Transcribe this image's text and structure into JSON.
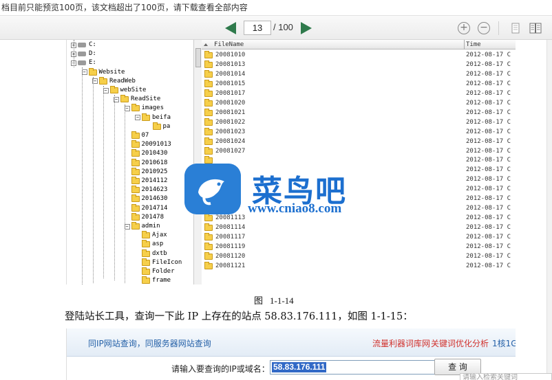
{
  "notice": "档目前只能预览100页，该文档超出了100页，请下载查看全部内容",
  "toolbar": {
    "page_current": "13",
    "page_total": "/ 100",
    "zoom_in": "+",
    "zoom_out": "−"
  },
  "figure1": {
    "tree": [
      {
        "label": "C:",
        "type": "drive",
        "depth": 0
      },
      {
        "label": "D:",
        "type": "drive",
        "depth": 0
      },
      {
        "label": "E:",
        "type": "drive",
        "depth": 0,
        "expanded": true
      },
      {
        "label": "Website",
        "type": "folder",
        "depth": 1,
        "expanded": true
      },
      {
        "label": "ReadWeb",
        "type": "folder",
        "depth": 2,
        "expanded": true
      },
      {
        "label": "webSite",
        "type": "folder",
        "depth": 3,
        "expanded": true
      },
      {
        "label": "ReadSite",
        "type": "folder",
        "depth": 4,
        "expanded": true
      },
      {
        "label": "images",
        "type": "folder",
        "depth": 5,
        "expanded": true
      },
      {
        "label": "beifa",
        "type": "folder",
        "depth": 6,
        "expanded": true
      },
      {
        "label": "pa",
        "type": "folder",
        "depth": 7
      },
      {
        "label": "07",
        "type": "folder",
        "depth": 5
      },
      {
        "label": "20091013",
        "type": "folder",
        "depth": 5
      },
      {
        "label": "2010430",
        "type": "folder",
        "depth": 5
      },
      {
        "label": "2010618",
        "type": "folder",
        "depth": 5
      },
      {
        "label": "2010925",
        "type": "folder",
        "depth": 5
      },
      {
        "label": "2014112",
        "type": "folder",
        "depth": 5
      },
      {
        "label": "2014623",
        "type": "folder",
        "depth": 5
      },
      {
        "label": "2014630",
        "type": "folder",
        "depth": 5
      },
      {
        "label": "2014714",
        "type": "folder",
        "depth": 5
      },
      {
        "label": "201478",
        "type": "folder",
        "depth": 5
      },
      {
        "label": "admin",
        "type": "folder",
        "depth": 5,
        "expanded": true
      },
      {
        "label": "Ajax",
        "type": "folder",
        "depth": 6
      },
      {
        "label": "asp",
        "type": "folder",
        "depth": 6
      },
      {
        "label": "dxtb",
        "type": "folder",
        "depth": 6
      },
      {
        "label": "FileIcon",
        "type": "folder",
        "depth": 6
      },
      {
        "label": "Folder",
        "type": "folder",
        "depth": 6
      },
      {
        "label": "frame",
        "type": "folder",
        "depth": 6
      }
    ],
    "list_header": {
      "name": "FileName",
      "time": "Time"
    },
    "files": [
      {
        "name": "20081010",
        "time": "2012-08-17  C"
      },
      {
        "name": "20081013",
        "time": "2012-08-17  C"
      },
      {
        "name": "20081014",
        "time": "2012-08-17  C"
      },
      {
        "name": "20081015",
        "time": "2012-08-17  C"
      },
      {
        "name": "20081017",
        "time": "2012-08-17  C"
      },
      {
        "name": "20081020",
        "time": "2012-08-17  C"
      },
      {
        "name": "20081021",
        "time": "2012-08-17  C"
      },
      {
        "name": "20081022",
        "time": "2012-08-17  C"
      },
      {
        "name": "20081023",
        "time": "2012-08-17  C"
      },
      {
        "name": "20081024",
        "time": "2012-08-17  C"
      },
      {
        "name": "20081027",
        "time": "2012-08-17  C"
      },
      {
        "name": "",
        "time": "2012-08-17  C"
      },
      {
        "name": "",
        "time": "2012-08-17  C"
      },
      {
        "name": "",
        "time": "2012-08-17  C"
      },
      {
        "name": "",
        "time": "2012-08-17  C"
      },
      {
        "name": "",
        "time": "2012-08-17  C"
      },
      {
        "name": "",
        "time": "2012-08-17  C"
      },
      {
        "name": "20081113",
        "time": "2012-08-17  C"
      },
      {
        "name": "20081114",
        "time": "2012-08-17  C"
      },
      {
        "name": "20081117",
        "time": "2012-08-17  C"
      },
      {
        "name": "20081119",
        "time": "2012-08-17  C"
      },
      {
        "name": "20081120",
        "time": "2012-08-17  C"
      },
      {
        "name": "20081121",
        "time": "2012-08-17  C"
      }
    ]
  },
  "watermark": {
    "title": "菜鸟吧",
    "url": "www.cniao8.com"
  },
  "caption": {
    "prefix": "图",
    "number": "1-1-14"
  },
  "paragraph": "登陆站长工具，查询一下此 IP 上存在的站点 58.83.176.111，如图 1-1-15：",
  "figure2": {
    "nav_left": "同IP网站查询，同服务器网站查询",
    "nav_red1": "流量利器词库网",
    "nav_red2": "关键词优化分析",
    "nav_blue": "1核1G",
    "input_label": "请输入要查询的IP或域名：",
    "input_value": "58.83.176.111",
    "query_button": "查 询"
  },
  "bottom_input_placeholder": "请输入检索关键词"
}
